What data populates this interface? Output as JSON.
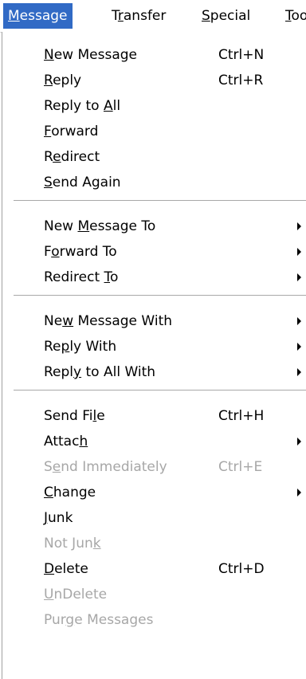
{
  "menubar": {
    "items": [
      {
        "before": "",
        "u": "M",
        "after": "essage",
        "active": true
      },
      {
        "before": "T",
        "u": "r",
        "after": "ansfer",
        "active": false
      },
      {
        "before": "",
        "u": "S",
        "after": "pecial",
        "active": false
      },
      {
        "before": "",
        "u": "T",
        "after": "oo",
        "active": false
      }
    ]
  },
  "menu": {
    "items": [
      {
        "before": "",
        "u": "N",
        "after": "ew Message",
        "shortcut": "Ctrl+N",
        "submenu": false,
        "disabled": false
      },
      {
        "before": "",
        "u": "R",
        "after": "eply",
        "shortcut": "Ctrl+R",
        "submenu": false,
        "disabled": false
      },
      {
        "before": "Reply to ",
        "u": "A",
        "after": "ll",
        "shortcut": "",
        "submenu": false,
        "disabled": false
      },
      {
        "before": "",
        "u": "F",
        "after": "orward",
        "shortcut": "",
        "submenu": false,
        "disabled": false
      },
      {
        "before": "R",
        "u": "e",
        "after": "direct",
        "shortcut": "",
        "submenu": false,
        "disabled": false
      },
      {
        "before": "",
        "u": "S",
        "after": "end Again",
        "shortcut": "",
        "submenu": false,
        "disabled": false
      },
      {
        "before": "New ",
        "u": "M",
        "after": "essage To",
        "shortcut": "",
        "submenu": true,
        "disabled": false
      },
      {
        "before": "F",
        "u": "o",
        "after": "rward To",
        "shortcut": "",
        "submenu": true,
        "disabled": false
      },
      {
        "before": "Redirect ",
        "u": "T",
        "after": "o",
        "shortcut": "",
        "submenu": true,
        "disabled": false
      },
      {
        "before": "Ne",
        "u": "w",
        "after": " Message With",
        "shortcut": "",
        "submenu": true,
        "disabled": false
      },
      {
        "before": "Re",
        "u": "p",
        "after": "ly With",
        "shortcut": "",
        "submenu": true,
        "disabled": false
      },
      {
        "before": "Repl",
        "u": "y",
        "after": " to All With",
        "shortcut": "",
        "submenu": true,
        "disabled": false
      },
      {
        "before": "Send Fi",
        "u": "l",
        "after": "e",
        "shortcut": "Ctrl+H",
        "submenu": false,
        "disabled": false
      },
      {
        "before": "Attac",
        "u": "h",
        "after": "",
        "shortcut": "",
        "submenu": true,
        "disabled": false
      },
      {
        "before": "S",
        "u": "e",
        "after": "nd Immediately",
        "shortcut": "Ctrl+E",
        "submenu": false,
        "disabled": true
      },
      {
        "before": "",
        "u": "C",
        "after": "hange",
        "shortcut": "",
        "submenu": true,
        "disabled": false
      },
      {
        "before": "",
        "u": "J",
        "after": "unk",
        "shortcut": "",
        "submenu": false,
        "disabled": false
      },
      {
        "before": "Not Jun",
        "u": "k",
        "after": "",
        "shortcut": "",
        "submenu": false,
        "disabled": true
      },
      {
        "before": "",
        "u": "D",
        "after": "elete",
        "shortcut": "Ctrl+D",
        "submenu": false,
        "disabled": false
      },
      {
        "before": "",
        "u": "U",
        "after": "nDelete",
        "shortcut": "",
        "submenu": false,
        "disabled": true
      },
      {
        "before": "Pur",
        "u": "g",
        "after": "e Messages",
        "shortcut": "",
        "submenu": false,
        "disabled": true
      }
    ]
  }
}
